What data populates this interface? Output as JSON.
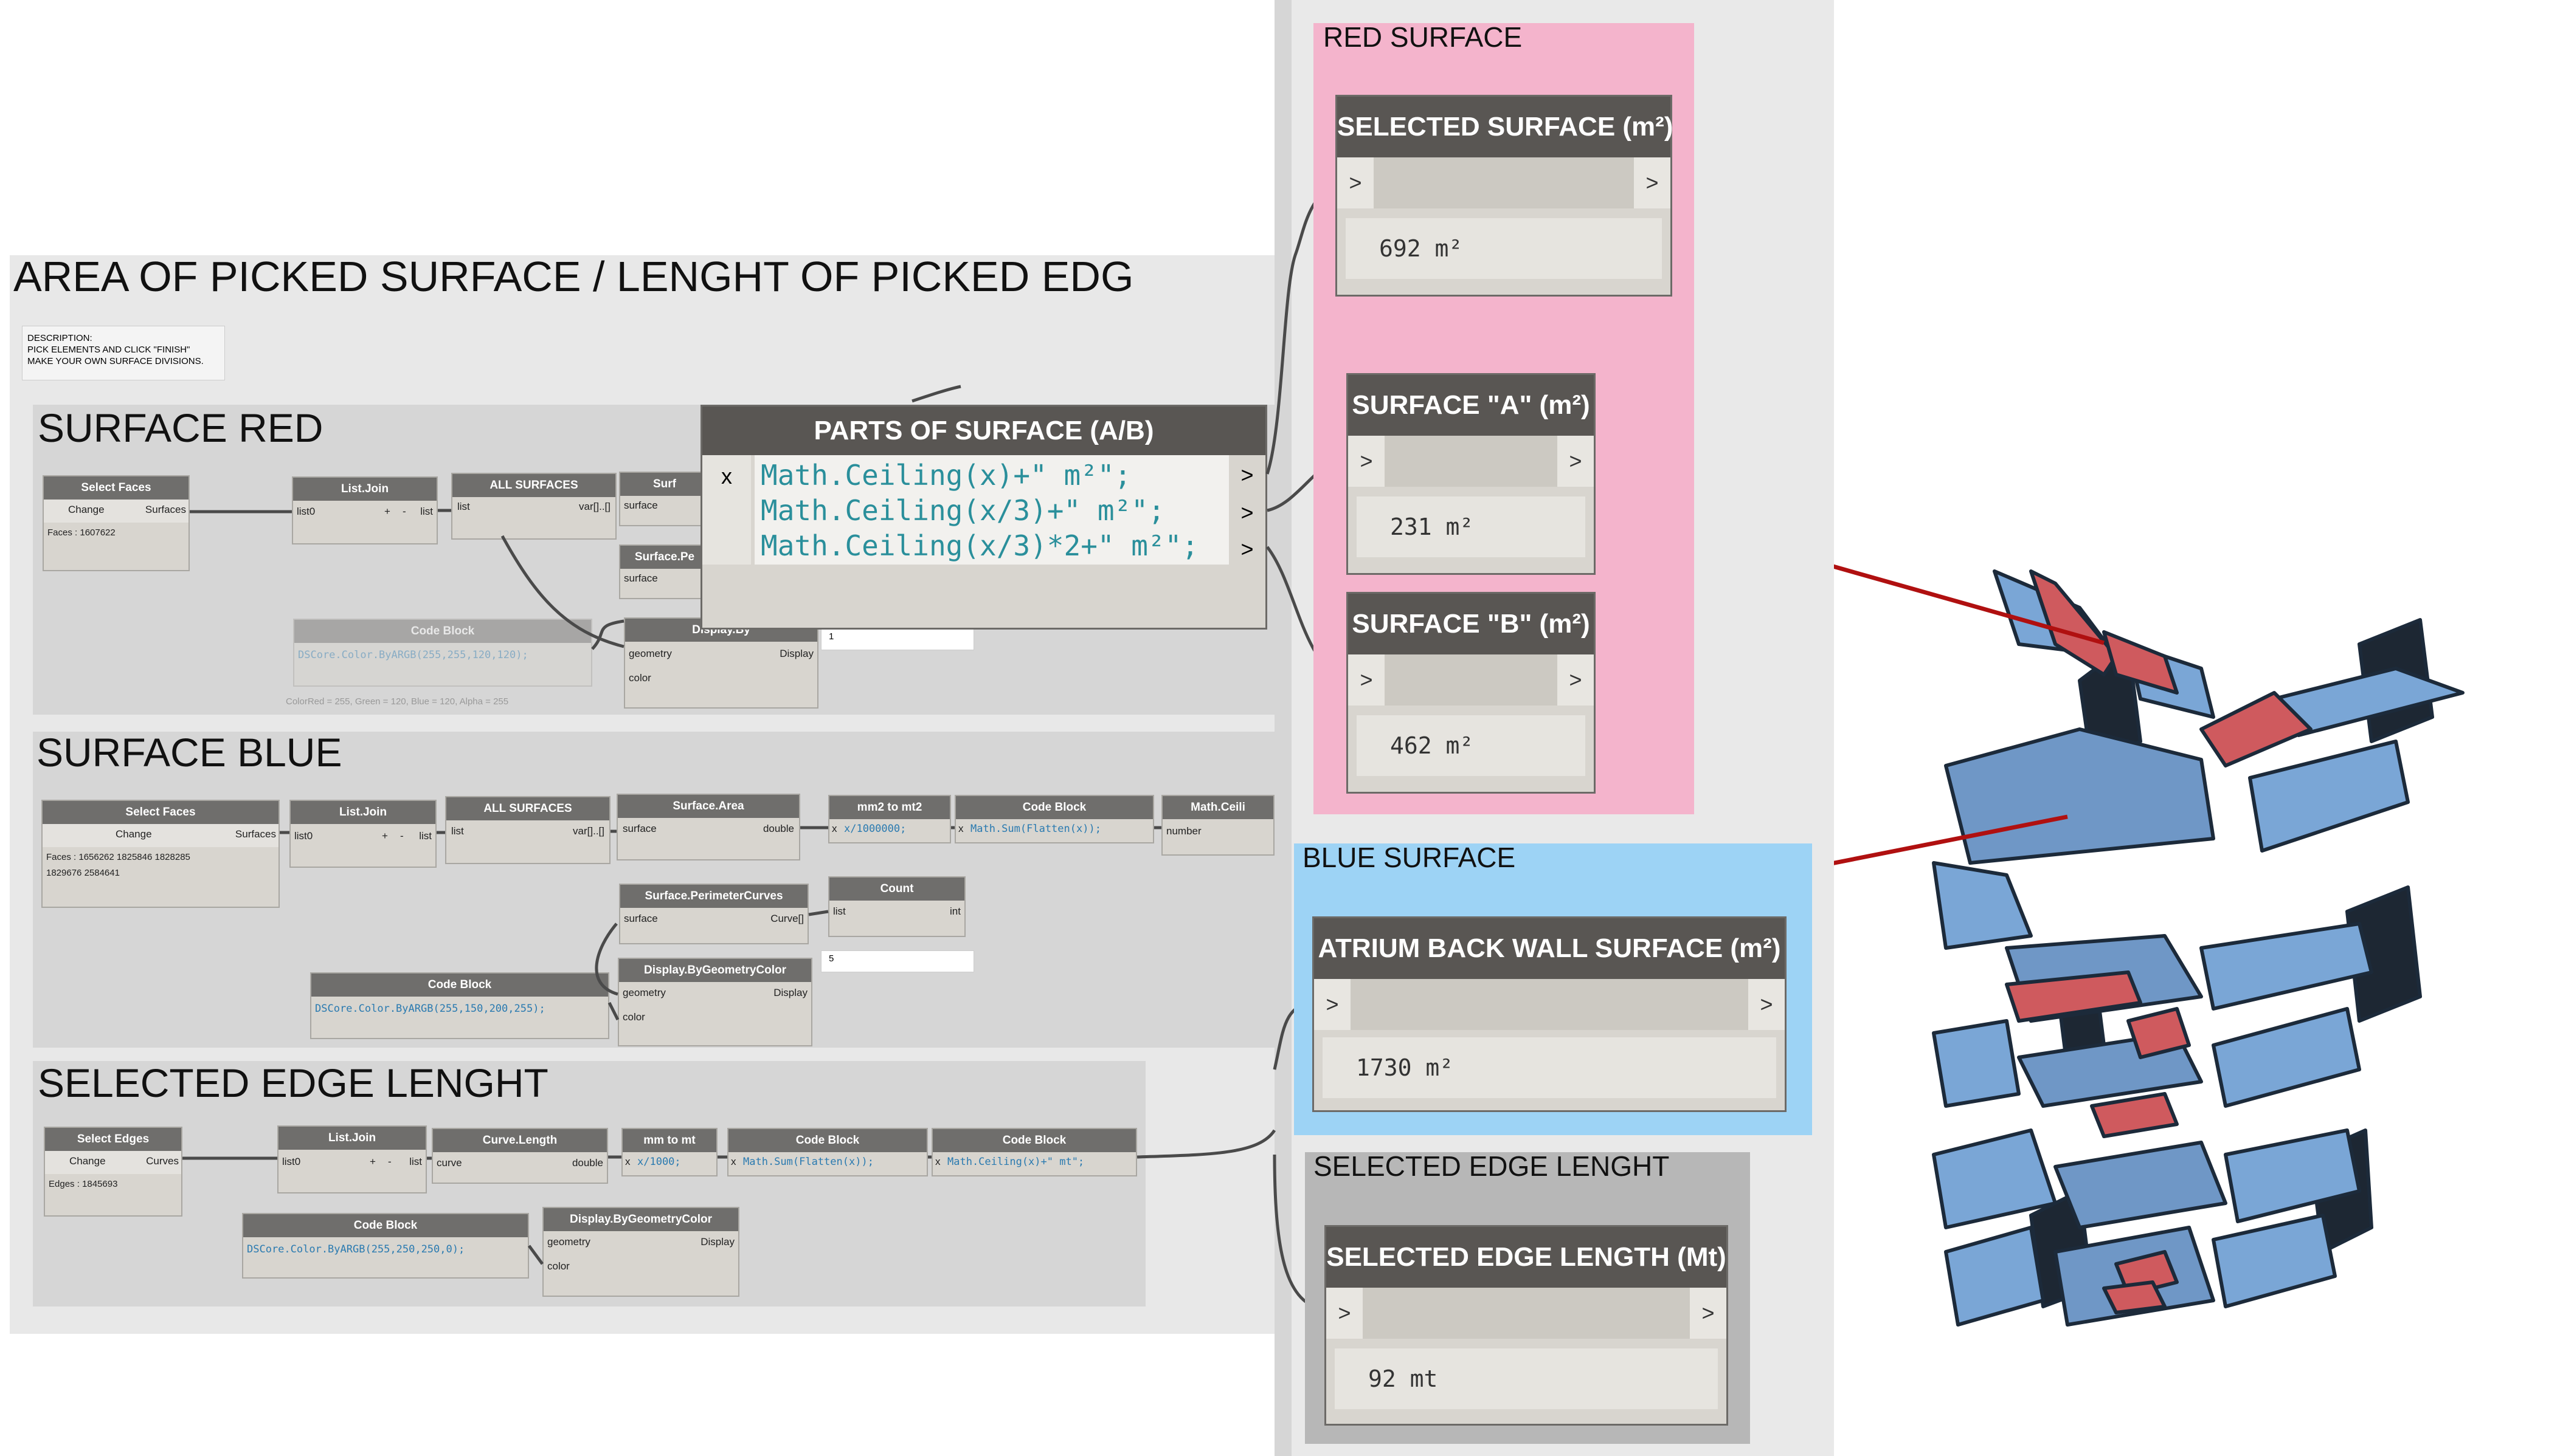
{
  "main_title": "AREA OF PICKED SURFACE / LENGHT OF PICKED EDG",
  "description": [
    "DESCRIPTION:",
    "PICK ELEMENTS AND CLICK \"FINISH\"",
    "MAKE YOUR OWN SURFACE DIVISIONS."
  ],
  "groups": {
    "red": "SURFACE RED",
    "blue": "SURFACE BLUE",
    "edge": "SELECTED EDGE LENGHT"
  },
  "output_groups": {
    "red": "RED SURFACE",
    "blue": "BLUE SURFACE",
    "edge": "SELECTED EDGE LENGHT"
  },
  "red_nodes": {
    "select_faces": {
      "title": "Select Faces",
      "button": "Change",
      "out": "Surfaces",
      "preview": "Faces : 1607622"
    },
    "list_join": {
      "title": "List.Join",
      "in": "list0",
      "out": "list"
    },
    "all_surfaces": {
      "title": "ALL SURFACES",
      "in": "list",
      "out": "var[]..[]"
    },
    "surface_area": {
      "title": "Surf",
      "in": "surface"
    },
    "perimeter": {
      "title": "Surface.Pe",
      "in": "surface"
    },
    "display": {
      "title": "Display.By",
      "in1": "geometry",
      "in2": "color",
      "out": "Display"
    },
    "code_block": {
      "title": "Code Block",
      "code": "DSCore.Color.ByARGB(255,255,120,120);",
      "note": "ColorRed = 255, Green = 120, Blue = 120, Alpha = 255"
    },
    "count_value": "1"
  },
  "parts_node": {
    "title": "PARTS OF SURFACE (A/B)",
    "in": "x",
    "out": ">",
    "lines": [
      "Math.Ceiling(x)+\" m²\";",
      "Math.Ceiling(x/3)+\" m²\";",
      "Math.Ceiling(x/3)*2+\" m²\";"
    ]
  },
  "blue_nodes": {
    "select_faces": {
      "title": "Select Faces",
      "button": "Change",
      "out": "Surfaces",
      "preview": "Faces : 1656262 1825846 1828285 1829676 2584641"
    },
    "list_join": {
      "title": "List.Join",
      "in": "list0",
      "out": "list"
    },
    "all_surfaces": {
      "title": "ALL SURFACES",
      "in": "list",
      "out": "var[]..[]"
    },
    "surface_area": {
      "title": "Surface.Area",
      "in": "surface",
      "out": "double"
    },
    "mm2_to_mt2": {
      "title": "mm2 to mt2",
      "in": "x",
      "code": "x/1000000;"
    },
    "code_block": {
      "title": "Code Block",
      "in": "x",
      "code": "Math.Sum(Flatten(x));"
    },
    "math_ceiling": {
      "title": "Math.Ceili",
      "in": "number"
    },
    "perimeter": {
      "title": "Surface.PerimeterCurves",
      "in": "surface",
      "out": "Curve[]"
    },
    "count": {
      "title": "Count",
      "in": "list",
      "out": "int",
      "value": "5"
    },
    "color_block": {
      "title": "Code Block",
      "code": "DSCore.Color.ByARGB(255,150,200,255);"
    },
    "display": {
      "title": "Display.ByGeometryColor",
      "in1": "geometry",
      "in2": "color",
      "out": "Display"
    }
  },
  "edge_nodes": {
    "select_edges": {
      "title": "Select Edges",
      "button": "Change",
      "out": "Curves",
      "preview": "Edges : 1845693"
    },
    "list_join": {
      "title": "List.Join",
      "in": "list0",
      "out": "list"
    },
    "curve_length": {
      "title": "Curve.Length",
      "in": "curve",
      "out": "double"
    },
    "mm_to_mt": {
      "title": "mm to mt",
      "in": "x",
      "code": "x/1000;"
    },
    "code_block1": {
      "title": "Code Block",
      "in": "x",
      "code": "Math.Sum(Flatten(x));"
    },
    "code_block2": {
      "title": "Code Block",
      "in": "x",
      "code": "Math.Ceiling(x)+\" mt\";"
    },
    "color_block": {
      "title": "Code Block",
      "code": "DSCore.Color.ByARGB(255,250,250,0);"
    },
    "display": {
      "title": "Display.ByGeometryColor",
      "in1": "geometry",
      "in2": "color",
      "out": "Display"
    }
  },
  "watches": {
    "selected_surface": {
      "title": "SELECTED SURFACE (m²)",
      "value": "692 m²"
    },
    "surface_a": {
      "title": "SURFACE \"A\" (m²)",
      "value": "231 m²"
    },
    "surface_b": {
      "title": "SURFACE \"B\" (m²)",
      "value": "462 m²"
    },
    "atrium": {
      "title": "ATRIUM BACK WALL SURFACE (m²)",
      "value": "1730 m²"
    },
    "edge_length": {
      "title": "SELECTED EDGE LENGTH (Mt)",
      "value": "92 mt"
    }
  },
  "port_glyphs": {
    "in": ">",
    "out": ">",
    "add": "+",
    "remove": "-"
  },
  "colors": {
    "red_group": "#f4b4cc",
    "blue_group": "#9dd3f5",
    "edge_group": "#b7b7b7",
    "canvas_group": "#e8e8e8",
    "arrow": "#b01010"
  }
}
